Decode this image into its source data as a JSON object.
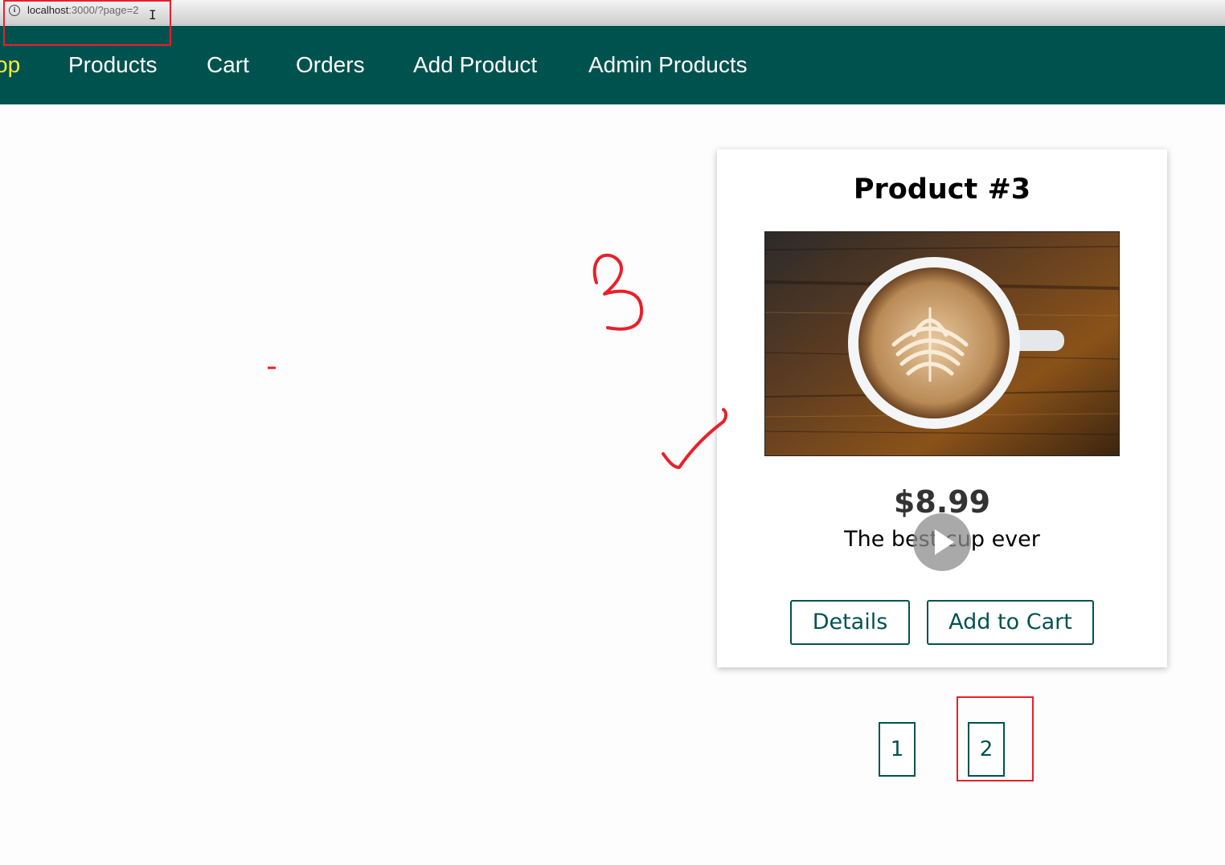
{
  "browser": {
    "url_host": "localhost",
    "url_path": ":3000/?page=2",
    "info_icon": "info-circle-icon",
    "cursor_icon": "text-cursor-icon"
  },
  "nav": {
    "shop_partial": "op",
    "items": [
      "Products",
      "Cart",
      "Orders",
      "Add Product",
      "Admin Products"
    ],
    "colors": {
      "header_bg": "#00524f",
      "active": "#ffeb3b",
      "text": "#ffffff"
    }
  },
  "product": {
    "title": "Product #3",
    "image": "coffee-latte-art-image",
    "price": "$8.99",
    "description": "The best cup ever",
    "details_label": "Details",
    "add_to_cart_label": "Add to Cart"
  },
  "video_overlay": {
    "icon": "play-icon"
  },
  "pagination": {
    "pages": [
      "1",
      "2"
    ]
  },
  "annotations": {
    "color": "#e8202a",
    "shapes": [
      "url-highlight-box",
      "number-3-drawing",
      "dash-mark",
      "checkmark",
      "page-2-highlight-box"
    ]
  }
}
